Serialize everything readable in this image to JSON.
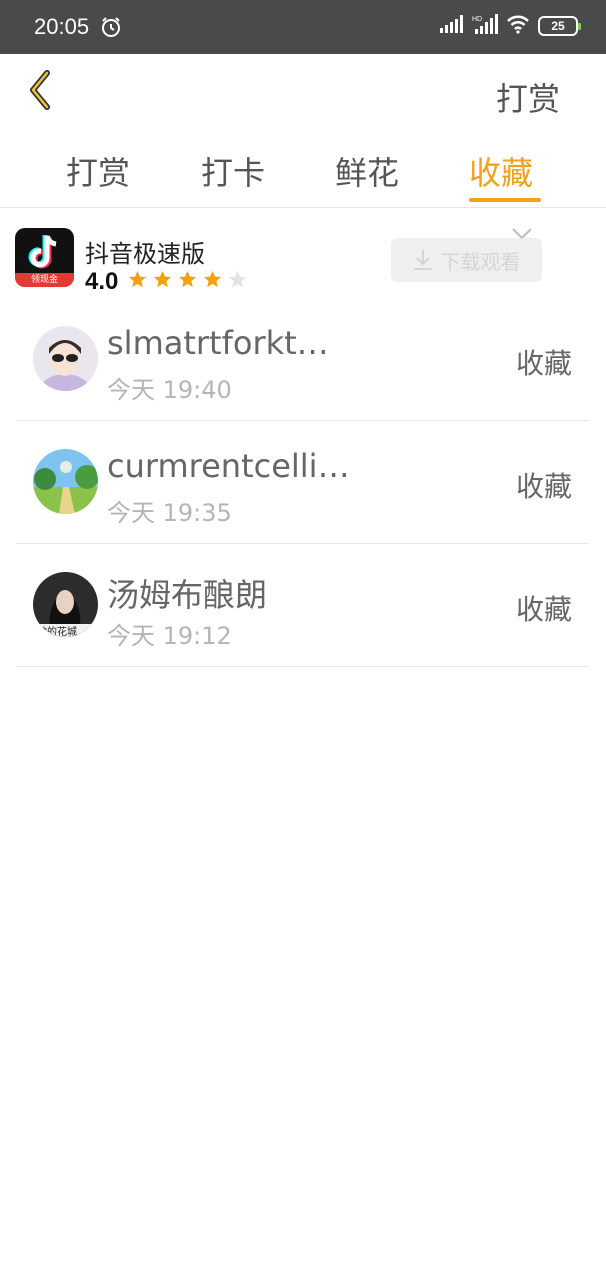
{
  "status_bar": {
    "time": "20:05",
    "battery": "25",
    "icons": [
      "alarm-icon",
      "signal-icon",
      "hd-signal-icon",
      "wifi-icon",
      "battery-icon"
    ]
  },
  "header": {
    "right_label": "打赏",
    "accent_color": "#f1a21a"
  },
  "tabs": [
    {
      "label": "打赏",
      "active": false
    },
    {
      "label": "打卡",
      "active": false
    },
    {
      "label": "鲜花",
      "active": false
    },
    {
      "label": "收藏",
      "active": true
    }
  ],
  "ad": {
    "app_name": "抖音极速版",
    "rating": "4.0",
    "stars_filled": 4,
    "stars_total": 5,
    "logo_tag": "领现金",
    "download_label": "下载观看"
  },
  "list": [
    {
      "username": "slmatrtforkt…",
      "time": "今天 19:40",
      "action": "收藏"
    },
    {
      "username": "curmrentcelli…",
      "time": "今天 19:35",
      "action": "收藏"
    },
    {
      "username": "汤姆布酿朗",
      "time": "今天 19:12",
      "action": "收藏"
    }
  ]
}
